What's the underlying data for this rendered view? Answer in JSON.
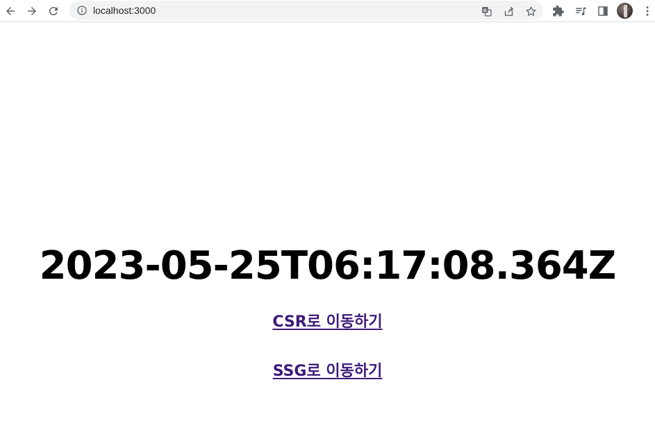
{
  "browser": {
    "url": "localhost:3000",
    "icons": {
      "back": "back-arrow-icon",
      "forward": "forward-arrow-icon",
      "reload": "reload-icon",
      "site_info": "info-icon",
      "translate": "translate-icon",
      "share": "share-icon",
      "bookmark": "star-icon",
      "extensions": "puzzle-icon",
      "media": "media-queue-icon",
      "side_panel": "side-panel-icon",
      "profile": "avatar",
      "menu": "kebab-menu-icon"
    }
  },
  "page": {
    "timestamp": "2023-05-25T06:17:08.364Z",
    "links": [
      {
        "label": "CSR로 이동하기"
      },
      {
        "label": "SSG로 이동하기"
      }
    ],
    "colors": {
      "link": "#3c1a78",
      "text": "#000000"
    }
  }
}
